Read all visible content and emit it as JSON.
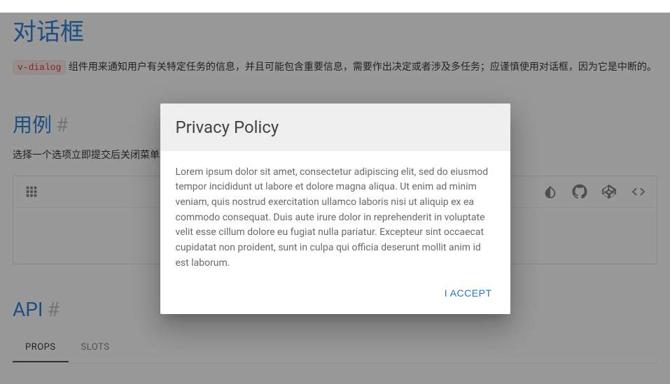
{
  "page": {
    "title": "对话框",
    "code_chip": "v-dialog",
    "desc_after": " 组件用来通知用户有关特定任务的信息，并且可能包含重要信息，需要作出决定或者涉及多任务；应谨慎使用对话框，因为它是中断的。"
  },
  "usage": {
    "heading": "用例",
    "subdesc": "选择一个选项立即提交后关闭菜单。"
  },
  "api": {
    "heading": "API",
    "tabs": [
      "PROPS",
      "SLOTS"
    ],
    "active_tab": 0
  },
  "dialog": {
    "title": "Privacy Policy",
    "body": "Lorem ipsum dolor sit amet, consectetur adipiscing elit, sed do eiusmod tempor incididunt ut labore et dolore magna aliqua. Ut enim ad minim veniam, quis nostrud exercitation ullamco laboris nisi ut aliquip ex ea commodo consequat. Duis aute irure dolor in reprehenderit in voluptate velit esse cillum dolore eu fugiat nulla pariatur. Excepteur sint occaecat cupidatat non proident, sunt in culpa qui officia deserunt mollit anim id est laborum.",
    "accept_label": "I Accept"
  },
  "anchor": "#"
}
